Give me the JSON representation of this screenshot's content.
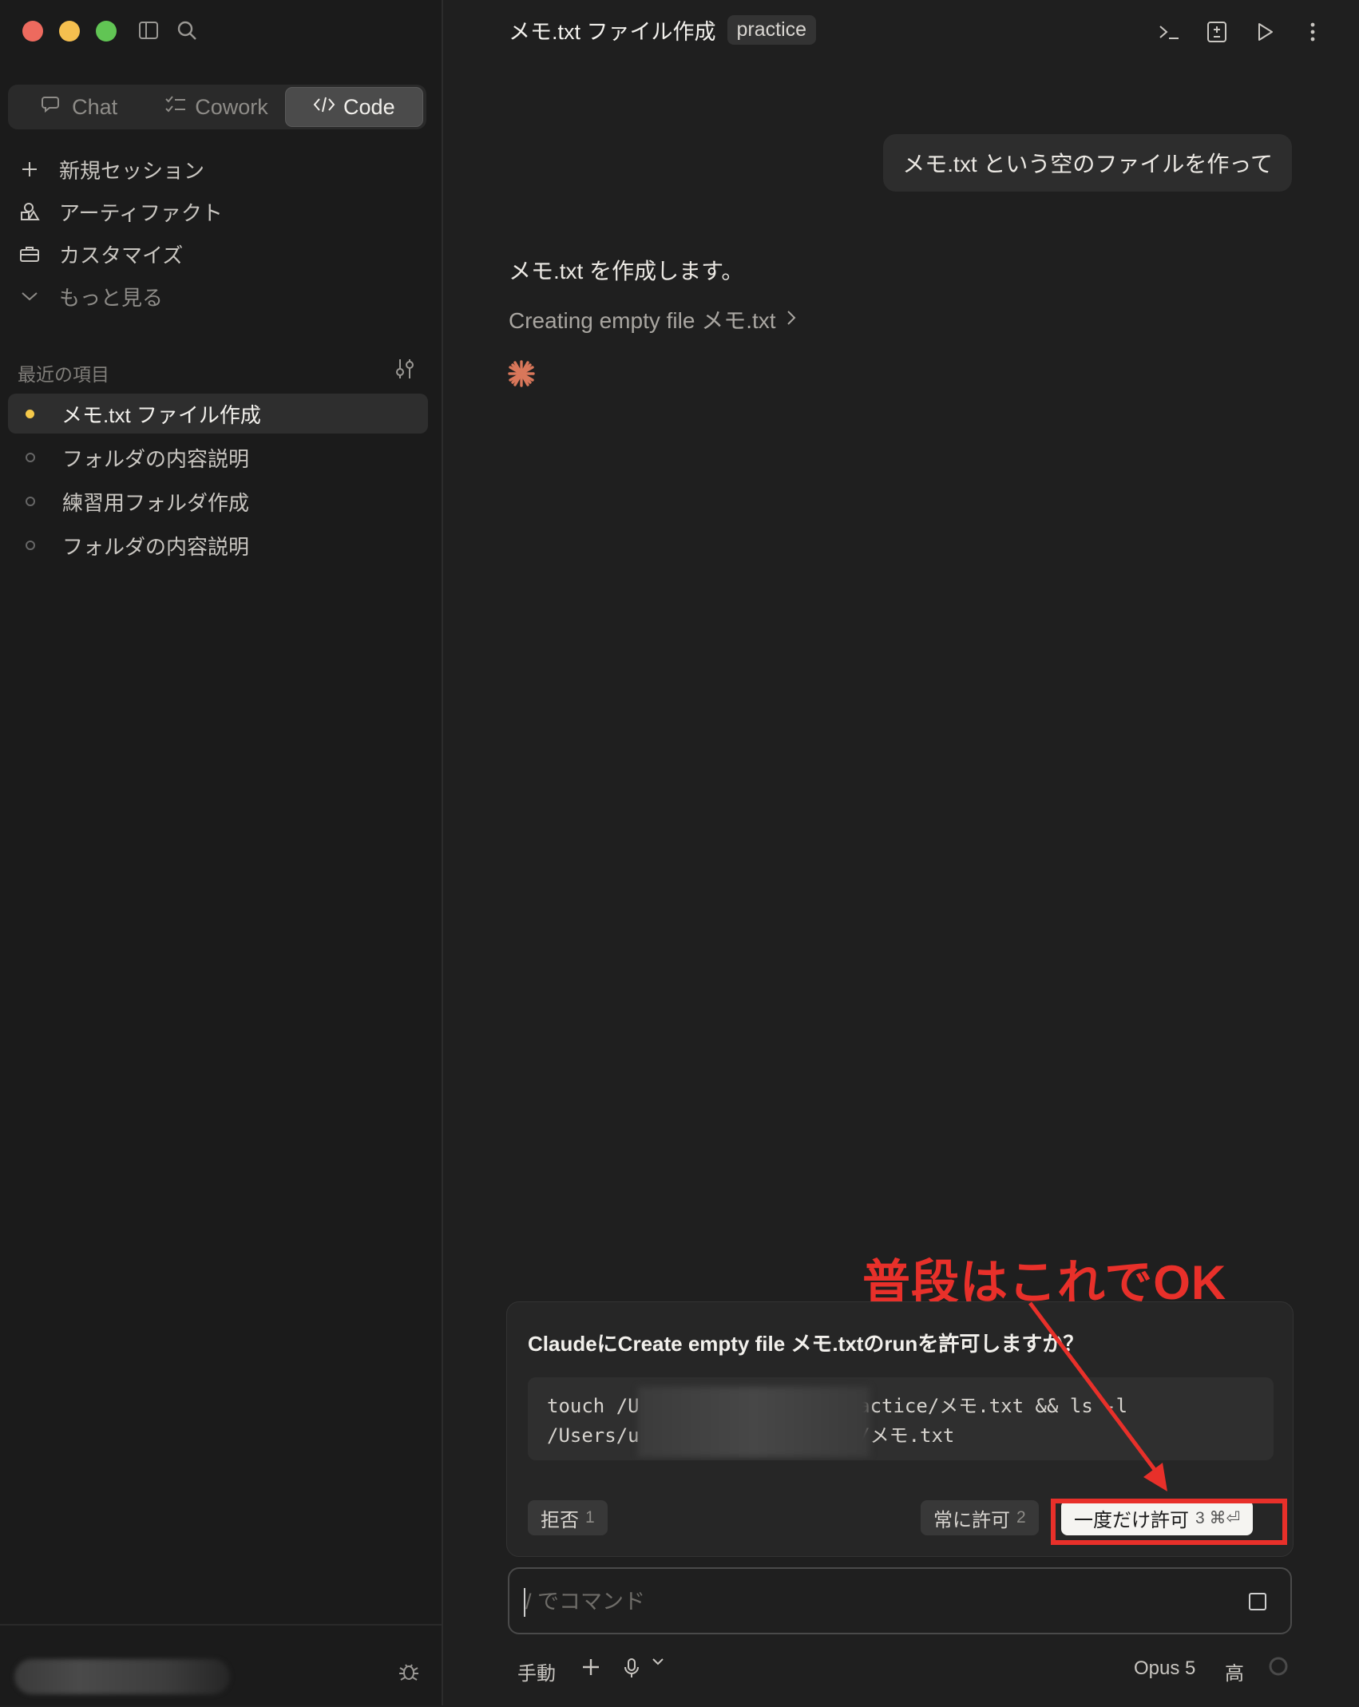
{
  "sidebar": {
    "modes": [
      "Chat",
      "Cowork",
      "Code"
    ],
    "nav": [
      {
        "label": "新規セッション",
        "icon": "plus-icon"
      },
      {
        "label": "アーティファクト",
        "icon": "shapes-icon"
      },
      {
        "label": "カスタマイズ",
        "icon": "briefcase-icon"
      },
      {
        "label": "もっと見る",
        "icon": "chevron-down-icon"
      }
    ],
    "recent_label": "最近の項目",
    "recent": [
      "メモ.txt ファイル作成",
      "フォルダの内容説明",
      "練習用フォルダ作成",
      "フォルダの内容説明"
    ]
  },
  "header": {
    "title": "メモ.txt ファイル作成",
    "badge": "practice"
  },
  "conversation": {
    "user_message": "メモ.txt という空のファイルを作って",
    "assistant_text": "メモ.txt を作成します。",
    "tool_line": "Creating empty file メモ.txt"
  },
  "permission": {
    "question": "ClaudeにCreate empty file メモ.txtのrunを許可しますか？",
    "code_line1": "touch /U                  ractice/メモ.txt && ls -l",
    "code_line2": "/Users/u                  e/メモ.txt",
    "deny_label": "拒否",
    "deny_key": "1",
    "always_label": "常に許可",
    "always_key": "2",
    "once_label": "一度だけ許可",
    "once_key": "3 ⌘⏎"
  },
  "annotation": {
    "text": "普段はこれでOK",
    "color": "#e8302a"
  },
  "composer": {
    "placeholder": "/ でコマンド"
  },
  "bottom_bar": {
    "mode": "手動",
    "model": "Opus 5",
    "effort": "高"
  },
  "colors": {
    "accent_spark": "#d9775a",
    "active_dot": "#f5c94a"
  }
}
